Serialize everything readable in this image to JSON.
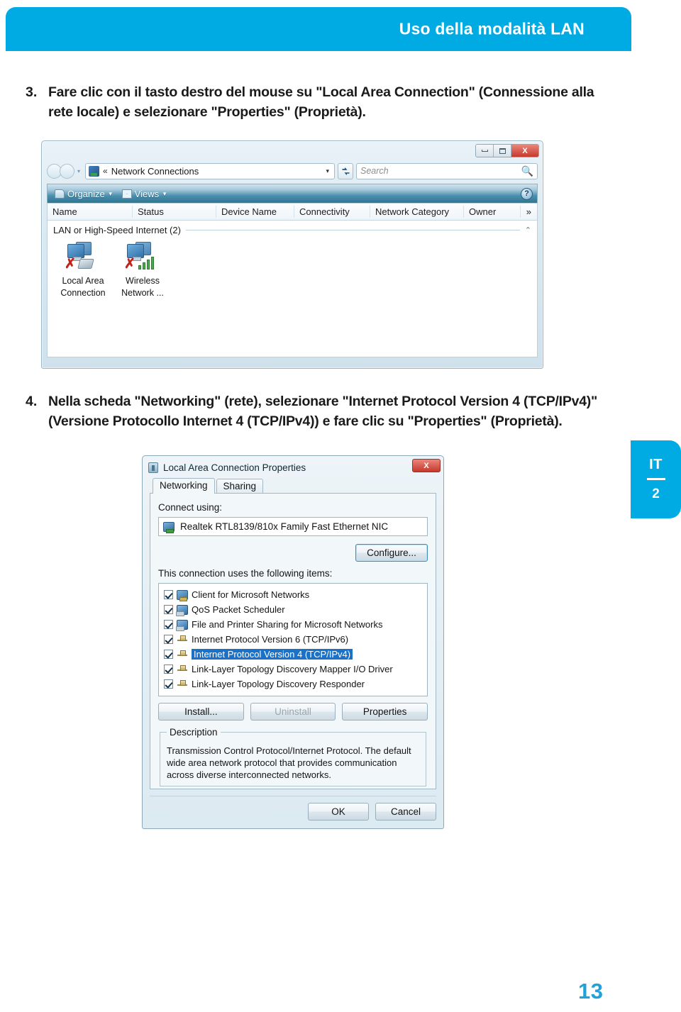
{
  "header": {
    "title": "Uso della modalità LAN",
    "accent": "#00ABE3"
  },
  "side_tab": {
    "language": "IT",
    "section": "2"
  },
  "folio": {
    "page_number": "13",
    "color": "#22A0D8"
  },
  "steps": [
    {
      "number": "3.",
      "text": "Fare clic con il tasto destro del mouse su \"Local Area Connection\" (Connessione alla rete locale) e selezionare \"Properties\" (Proprietà)."
    },
    {
      "number": "4.",
      "text": "Nella scheda \"Networking\" (rete), selezionare \"Internet Protocol Version 4 (TCP/IPv4)\" (Versione Protocollo Internet  4 (TCP/IPv4)) e fare clic su \"Properties\" (Proprietà)."
    }
  ],
  "network_connections_window": {
    "title_buttons": {
      "minimize": "",
      "maximize": "",
      "close": "X"
    },
    "address": {
      "breadcrumb_chevron": "«",
      "path": "Network Connections",
      "dropdown_caret": "▼",
      "refresh": "↔"
    },
    "search": {
      "placeholder": "Search",
      "icon": "search-icon"
    },
    "toolbar": {
      "organize": "Organize",
      "views": "Views",
      "caret": "▼",
      "help": "?"
    },
    "columns": [
      "Name",
      "Status",
      "Device Name",
      "Connectivity",
      "Network Category",
      "Owner"
    ],
    "columns_overflow": "»",
    "group": {
      "label": "LAN or High-Speed Internet (2)",
      "collapse_chevron": "⌃"
    },
    "connections": [
      {
        "name_line1": "Local Area",
        "name_line2": "Connection",
        "overlay": "red-x",
        "badge": "ethernet-plug"
      },
      {
        "name_line1": "Wireless",
        "name_line2": "Network ...",
        "overlay": "red-x",
        "badge": "signal-bars"
      }
    ]
  },
  "properties_dialog": {
    "title": "Local Area Connection Properties",
    "close_label": "X",
    "tabs": [
      {
        "label": "Networking",
        "active": true
      },
      {
        "label": "Sharing",
        "active": false
      }
    ],
    "connect_using_label": "Connect using:",
    "adapter": "Realtek RTL8139/810x Family Fast Ethernet NIC",
    "configure_button": "Configure...",
    "items_label": "This connection uses the following items:",
    "items": [
      {
        "label": "Client for Microsoft Networks",
        "checked": true,
        "selected": false,
        "icon": "client-icon"
      },
      {
        "label": "QoS Packet Scheduler",
        "checked": true,
        "selected": false,
        "icon": "service-icon"
      },
      {
        "label": "File and Printer Sharing for Microsoft Networks",
        "checked": true,
        "selected": false,
        "icon": "service-icon"
      },
      {
        "label": "Internet Protocol Version 6 (TCP/IPv6)",
        "checked": true,
        "selected": false,
        "icon": "protocol-icon"
      },
      {
        "label": "Internet Protocol Version 4 (TCP/IPv4)",
        "checked": true,
        "selected": true,
        "icon": "protocol-icon"
      },
      {
        "label": "Link-Layer Topology Discovery Mapper I/O Driver",
        "checked": true,
        "selected": false,
        "icon": "protocol-icon"
      },
      {
        "label": "Link-Layer Topology Discovery Responder",
        "checked": true,
        "selected": false,
        "icon": "protocol-icon"
      }
    ],
    "buttons": {
      "install": "Install...",
      "uninstall": "Uninstall",
      "properties": "Properties",
      "ok": "OK",
      "cancel": "Cancel"
    },
    "description_legend": "Description",
    "description_text": "Transmission Control Protocol/Internet Protocol. The default wide area network protocol that provides communication across diverse interconnected networks."
  }
}
